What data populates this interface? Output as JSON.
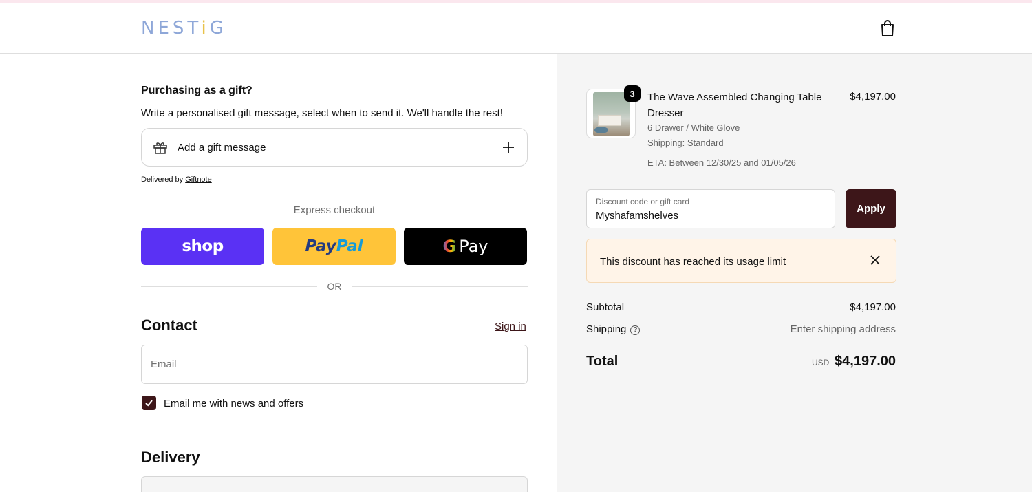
{
  "header": {
    "logo": {
      "pre": "NEST",
      "i": "i",
      "post": "G"
    },
    "cart_icon": "shopping-bag-icon"
  },
  "gift": {
    "title": "Purchasing as a gift?",
    "description": "Write a personalised gift message, select when to send it. We'll handle the rest!",
    "add_label": "Add a gift message",
    "delivered_prefix": "Delivered by",
    "delivered_link": "Giftnote"
  },
  "express": {
    "label": "Express checkout",
    "shop_label": "shop",
    "paypal_part1": "Pay",
    "paypal_part2": "Pal",
    "gpay_g": "G",
    "gpay_label": "Pay",
    "or_label": "OR"
  },
  "contact": {
    "title": "Contact",
    "sign_in": "Sign in",
    "email_placeholder": "Email",
    "newsletter_label": "Email me with news and offers",
    "newsletter_checked": true
  },
  "delivery": {
    "title": "Delivery"
  },
  "order": {
    "quantity_badge": "3",
    "product_name": "The Wave Assembled Changing Table Dresser",
    "variant": "6 Drawer / White Glove",
    "shipping_method": "Shipping: Standard",
    "eta": "ETA: Between 12/30/25 and 01/05/26",
    "price": "$4,197.00",
    "discount_label": "Discount code or gift card",
    "discount_value": "Myshafamshelves",
    "apply_label": "Apply",
    "alert_message": "This discount has reached its usage limit",
    "subtotal_label": "Subtotal",
    "subtotal_value": "$4,197.00",
    "shipping_label": "Shipping",
    "shipping_value": "Enter shipping address",
    "total_label": "Total",
    "total_currency": "USD",
    "total_value": "$4,197.00"
  },
  "colors": {
    "accent": "#3d1619",
    "shop": "#5a31f4",
    "paypal": "#ffc439",
    "alert_bg": "#fff4e8"
  }
}
